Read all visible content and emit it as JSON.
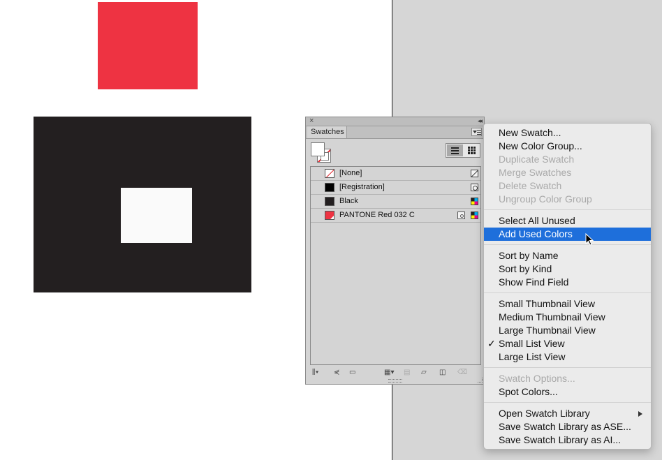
{
  "canvas": {
    "colors": {
      "red_object": "#ee3342",
      "black_object": "#231f20",
      "white_object": "#fafafa",
      "pasteboard": "#d6d6d6"
    }
  },
  "swatches_panel": {
    "close_icon": "×",
    "collapse_icon": "◂◂",
    "tab_label": "Swatches",
    "swatches": [
      {
        "name": "[None]",
        "chip": "none",
        "type_icon": "none-type-icon"
      },
      {
        "name": "[Registration]",
        "chip": "registration",
        "type_icon": "registration-type-icon"
      },
      {
        "name": "Black",
        "chip": "black",
        "type_icon": "cmyk-type-icon"
      },
      {
        "name": "PANTONE Red 032 C",
        "chip": "red",
        "color": "#ee3342",
        "type_icon": "cmyk-type-icon",
        "spot_icon": "spot-color-icon"
      }
    ],
    "bottom_icons": [
      "library-menu-icon",
      "show-kinds-icon",
      "swatch-options-icon",
      "new-color-group-icon",
      "new-swatch-icon",
      "delete-swatch-icon"
    ]
  },
  "flyout_menu": {
    "items": [
      {
        "label": "New Swatch...",
        "enabled": true
      },
      {
        "label": "New Color Group...",
        "enabled": true
      },
      {
        "label": "Duplicate Swatch",
        "enabled": false
      },
      {
        "label": "Merge Swatches",
        "enabled": false
      },
      {
        "label": "Delete Swatch",
        "enabled": false
      },
      {
        "label": "Ungroup Color Group",
        "enabled": false
      },
      {
        "label": "Select All Unused",
        "enabled": true
      },
      {
        "label": "Add Used Colors",
        "enabled": true,
        "highlighted": true
      },
      {
        "label": "Sort by Name",
        "enabled": true
      },
      {
        "label": "Sort by Kind",
        "enabled": true
      },
      {
        "label": "Show Find Field",
        "enabled": true
      },
      {
        "label": "Small Thumbnail View",
        "enabled": true
      },
      {
        "label": "Medium Thumbnail View",
        "enabled": true
      },
      {
        "label": "Large Thumbnail View",
        "enabled": true
      },
      {
        "label": "Small List View",
        "enabled": true,
        "checked": true
      },
      {
        "label": "Large List View",
        "enabled": true
      },
      {
        "label": "Swatch Options...",
        "enabled": false
      },
      {
        "label": "Spot Colors...",
        "enabled": true
      },
      {
        "label": "Open Swatch Library",
        "enabled": true,
        "submenu": true
      },
      {
        "label": "Save Swatch Library as ASE...",
        "enabled": true
      },
      {
        "label": "Save Swatch Library as AI...",
        "enabled": true
      }
    ],
    "checkmark": "✓",
    "highlight_color": "#1e6fdb"
  }
}
